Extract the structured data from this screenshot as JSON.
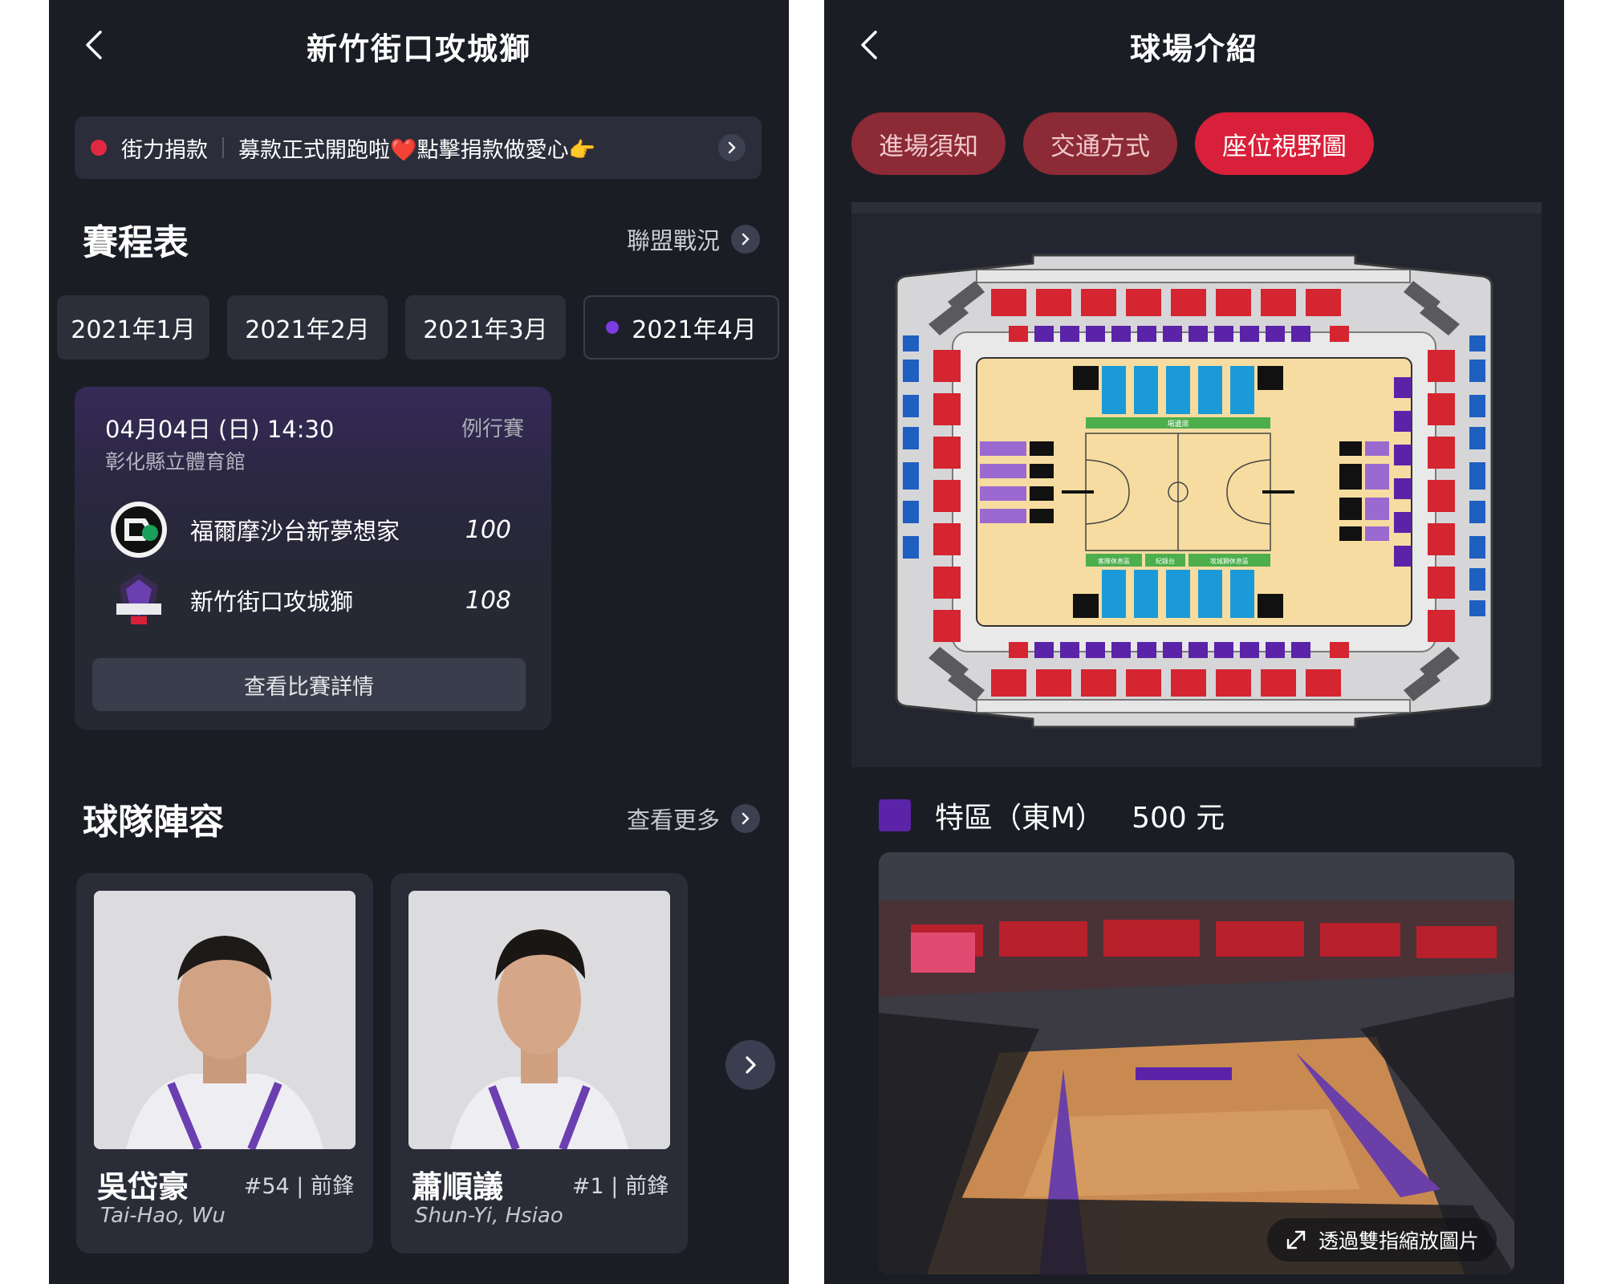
{
  "left": {
    "title": "新竹街口攻城獅",
    "banner": {
      "tag": "街力捐款",
      "text": "募款正式開跑啦❤️點擊捐款做愛心👉"
    },
    "schedule": {
      "title": "賽程表",
      "link": "聯盟戰況"
    },
    "months": [
      "2021年1月",
      "2021年2月",
      "2021年3月",
      "2021年4月"
    ],
    "active_month": "2021年4月",
    "game": {
      "datetime": "04月04日 (日) 14:30",
      "type": "例行賽",
      "venue": "彰化縣立體育館",
      "teams": [
        {
          "name": "福爾摩沙台新夢想家",
          "score": "100"
        },
        {
          "name": "新竹街口攻城獅",
          "score": "108"
        }
      ],
      "detail_button": "查看比賽詳情"
    },
    "roster": {
      "title": "球隊陣容",
      "link": "查看更多"
    },
    "players": [
      {
        "name": "吳岱豪",
        "meta": "#54 | 前鋒",
        "en": "Tai-Hao, Wu"
      },
      {
        "name": "蕭順議",
        "meta": "#1 | 前鋒",
        "en": "Shun-Yi, Hsiao"
      }
    ]
  },
  "right": {
    "title": "球場介紹",
    "tabs": [
      "進場須知",
      "交通方式",
      "座位視野圖"
    ],
    "active_tab": "座位視野圖",
    "map_labels": {
      "courtside": "場邊席",
      "away_bench": "客隊休息區",
      "scorer": "紀錄台",
      "home_bench": "攻城獅休息區"
    },
    "zone": {
      "name": "特區（東M）",
      "price": "500 元",
      "color": "#5a23a8"
    },
    "zoom_hint": "透過雙指縮放圖片"
  },
  "colors": {
    "accent_red": "#d8203a",
    "purple": "#5a23a8",
    "background": "#1b1d25"
  }
}
